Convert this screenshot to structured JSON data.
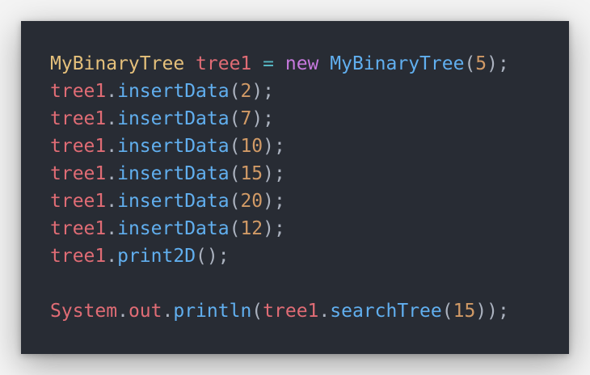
{
  "colors": {
    "background": "#f4f4f4",
    "editor_bg": "#282c34",
    "class": "#e5c07b",
    "variable": "#e06c75",
    "keyword": "#c678dd",
    "function": "#61afef",
    "number": "#d19a66",
    "operator": "#56b6c2",
    "punctuation": "#abb2bf"
  },
  "code": {
    "line1": {
      "type": "MyBinaryTree",
      "var": "tree1",
      "op": "=",
      "kw": "new",
      "ctor": "MyBinaryTree",
      "arg": "5"
    },
    "inserts": [
      {
        "obj": "tree1",
        "method": "insertData",
        "arg": "2"
      },
      {
        "obj": "tree1",
        "method": "insertData",
        "arg": "7"
      },
      {
        "obj": "tree1",
        "method": "insertData",
        "arg": "10"
      },
      {
        "obj": "tree1",
        "method": "insertData",
        "arg": "15"
      },
      {
        "obj": "tree1",
        "method": "insertData",
        "arg": "20"
      },
      {
        "obj": "tree1",
        "method": "insertData",
        "arg": "12"
      }
    ],
    "print_line": {
      "obj": "tree1",
      "method": "print2D"
    },
    "println_line": {
      "cls": "System",
      "field": "out",
      "method": "println",
      "obj": "tree1",
      "inner_method": "searchTree",
      "arg": "15"
    }
  }
}
